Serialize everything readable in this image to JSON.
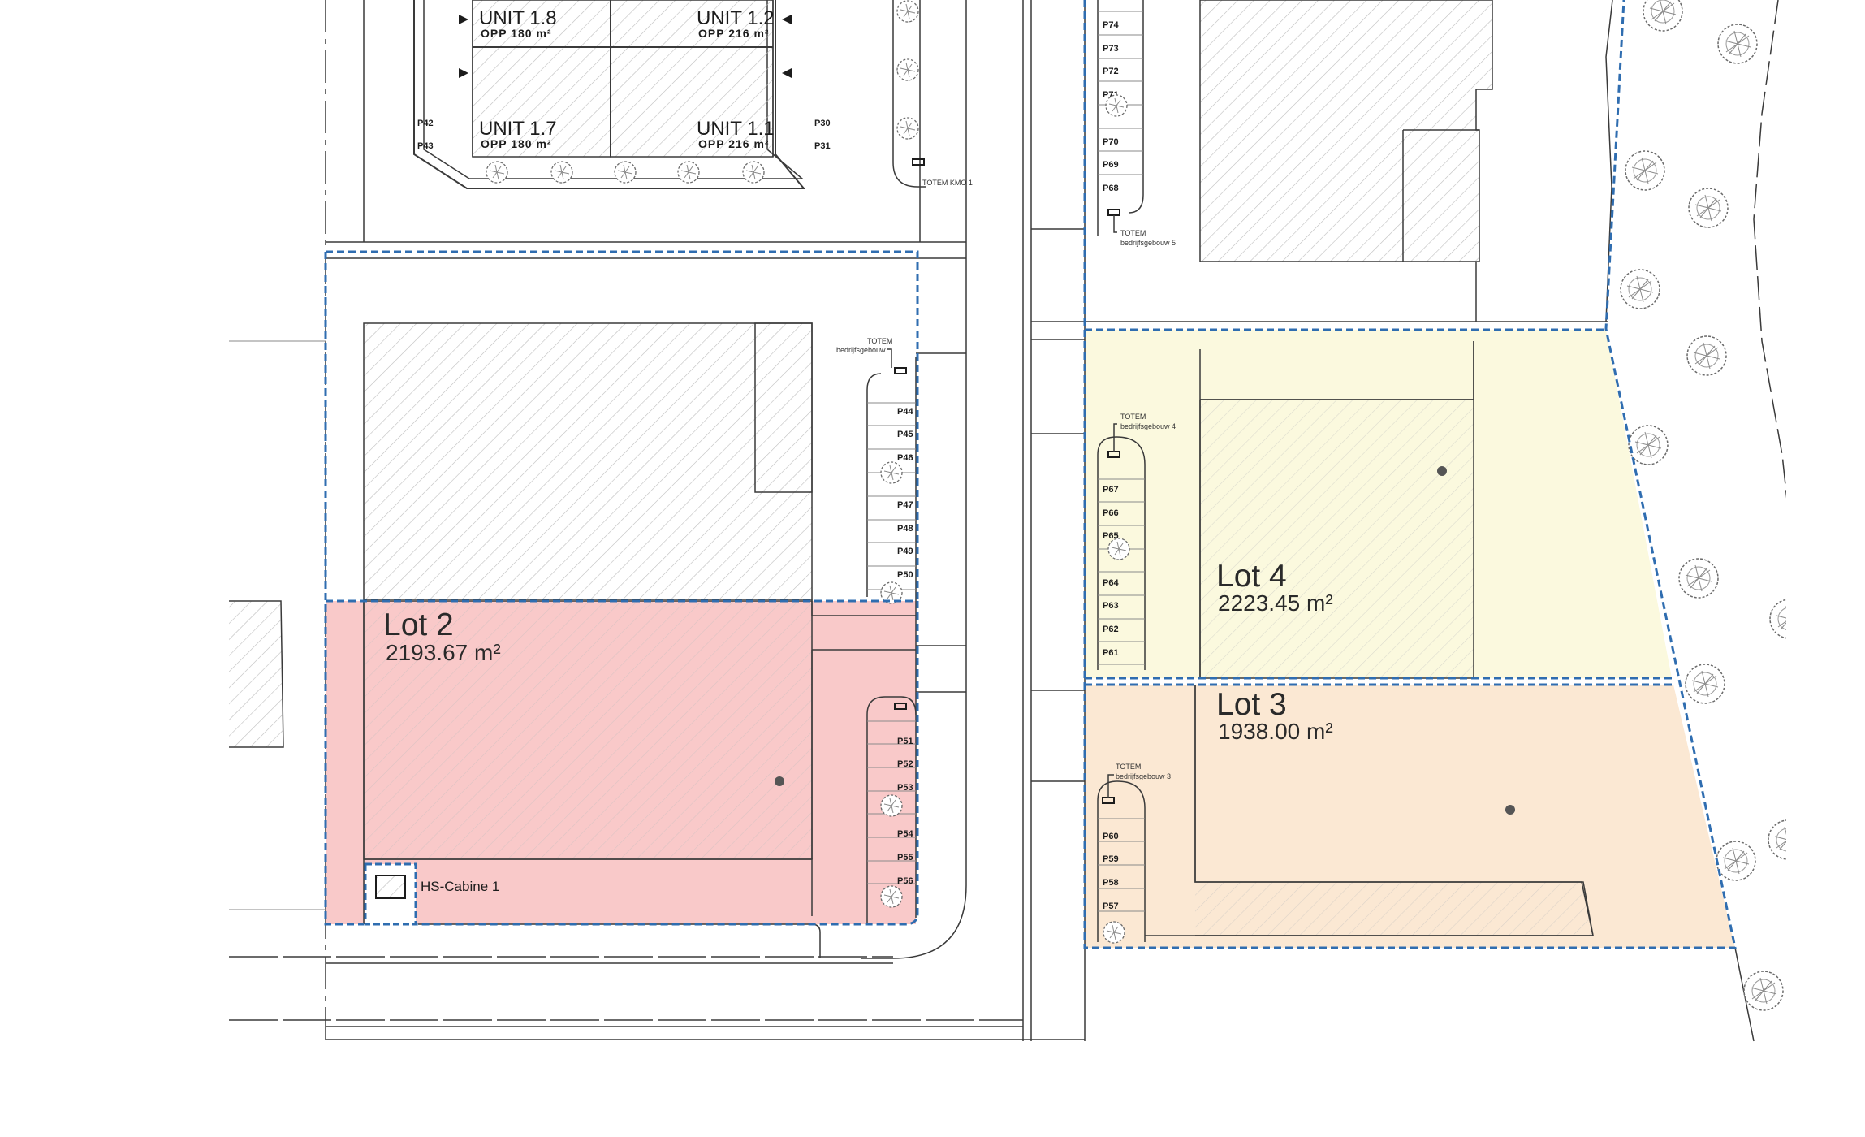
{
  "units": [
    {
      "name": "UNIT 1.8",
      "opp": "OPP 180 m²"
    },
    {
      "name": "UNIT 1.2",
      "opp": "OPP 216 m²"
    },
    {
      "name": "UNIT 1.7",
      "opp": "OPP 180 m²"
    },
    {
      "name": "UNIT 1.1",
      "opp": "OPP 216 m²"
    }
  ],
  "lots": {
    "lot2": {
      "name": "Lot 2",
      "area": "2193.67 m²",
      "color": "#f9c9c9"
    },
    "lot3": {
      "name": "Lot 3",
      "area": "1938.00 m²",
      "color": "#fbe8d3"
    },
    "lot4": {
      "name": "Lot 4",
      "area": "2223.45 m²",
      "color": "#fbf9de"
    }
  },
  "boundary_color": "#2f6db0",
  "hs_cabine": "HS-Cabine 1",
  "totems": {
    "kmo1": "TOTEM KMO 1",
    "b5_top": "TOTEM",
    "b5_bottom": "bedrijfsgebouw 5",
    "b_left_top": "TOTEM",
    "b_left_bottom": "bedrijfsgebouw",
    "b4_top": "TOTEM",
    "b4_bottom": "bedrijfsgebouw 4",
    "b3_top": "TOTEM",
    "b3_bottom": "bedrijfsgebouw 3"
  },
  "parking": {
    "top_left": [
      "P42",
      "P43"
    ],
    "top_right": [
      "P30",
      "P31"
    ],
    "right_column": [
      "P74",
      "P73",
      "P72",
      "P71",
      "P70",
      "P69",
      "P68"
    ],
    "left_column_upper": [
      "P44",
      "P45",
      "P46",
      "P47",
      "P48",
      "P49",
      "P50"
    ],
    "left_column_lower": [
      "P51",
      "P52",
      "P53",
      "P54",
      "P55",
      "P56"
    ],
    "lot4_column": [
      "P67",
      "P66",
      "P65",
      "P64",
      "P63",
      "P62",
      "P61"
    ],
    "lot3_column": [
      "P60",
      "P59",
      "P58",
      "P57"
    ]
  }
}
